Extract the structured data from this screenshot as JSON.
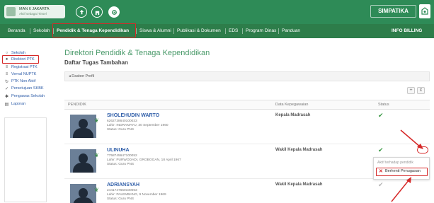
{
  "header": {
    "school_name": "MAN 6 JAKARTA",
    "school_sub": "Aktif sebagai Tinsel",
    "brand": "SIMPATIKA",
    "icons": [
      "upload-icon",
      "building-icon",
      "gear-icon"
    ]
  },
  "menu": {
    "items": [
      "Beranda",
      "Sekolah",
      "Pendidik & Tenaga Kependidikan",
      "Siswa & Alumni",
      "Publikasi & Dokumen",
      "EDS",
      "Program Dinas",
      "Panduan"
    ],
    "billing": "INFO BILLING",
    "active_index": 2
  },
  "sidebar": {
    "items": [
      {
        "label": "Sekolah",
        "icon": "circle-icon"
      },
      {
        "label": "Direktori PTK",
        "icon": "user-icon"
      },
      {
        "label": "Registrasi PTK",
        "icon": "list-icon"
      },
      {
        "label": "Verval NUPTK",
        "icon": "list-icon"
      },
      {
        "label": "PTK Non Aktif",
        "icon": "refresh-icon"
      },
      {
        "label": "Persetujuan SKBK",
        "icon": "check-icon"
      },
      {
        "label": "Pengawas Sekolah",
        "icon": "user-icon"
      },
      {
        "label": "Laporan",
        "icon": "document-icon"
      }
    ],
    "active_index": 1
  },
  "main": {
    "title": "Direktori Pendidik & Tenaga Kependidikan",
    "subtitle": "Daftar Tugas Tambahan",
    "breadcrumb": "Dasbor Profil",
    "buttons": [
      "+",
      "c"
    ],
    "columns": [
      "PENDIDIK",
      "Data Kepegawaian",
      "Status"
    ]
  },
  "rows": [
    {
      "name": "SHOLEHUDIN WARTO",
      "id": "6262738640100033",
      "birth": "Lahir: INDRAMAYU, 30 September 1960",
      "status": "Status: Guru PNS",
      "job": "Kepala Madrasah",
      "check": "✔"
    },
    {
      "name": "ULINUHA",
      "id": "7758745647100052",
      "birth": "Lahir: PURWODADI, GROBOGAN, 18 April 1967",
      "status": "Status: Guru PNS",
      "job": "Wakil Kepala Madrasah",
      "check": "✔"
    },
    {
      "name": "ADRIANSYAH",
      "id": "2441747650100063",
      "birth": "Lahir: PALEMBANG, 9 November 1969",
      "status": "Status: Guru PNS",
      "job": "Wakil Kepala Madrasah",
      "check": "✔"
    }
  ],
  "dropdown": {
    "header": "Aktif terhadap pendidik",
    "item": "Berhenti Penugasan",
    "item_icon": "x-icon"
  },
  "colors": {
    "header_green": "#2e8b57",
    "menu_green": "#2d7d4a",
    "title_green": "#4a9a6a",
    "link_blue": "#2e5da8",
    "highlight_red": "#d62828"
  }
}
